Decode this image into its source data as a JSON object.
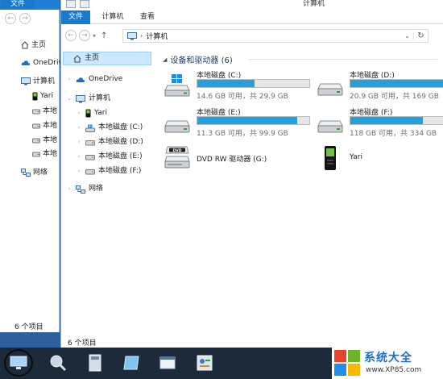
{
  "bg_window": {
    "file_tab": "文件",
    "nav": [
      {
        "label": "主页",
        "icon": "home-icon"
      },
      {
        "label": "OneDrive",
        "icon": "cloud-icon"
      },
      {
        "label": "计算机",
        "icon": "computer-icon"
      },
      {
        "label": "Yari",
        "icon": "phone-icon"
      },
      {
        "label": "本地",
        "icon": "drive-icon"
      },
      {
        "label": "本地",
        "icon": "drive-icon"
      },
      {
        "label": "本地",
        "icon": "drive-icon"
      },
      {
        "label": "本地",
        "icon": "drive-icon"
      },
      {
        "label": "网络",
        "icon": "network-icon"
      }
    ],
    "status": "6 个项目"
  },
  "window": {
    "title": "计算机",
    "tabs": [
      "文件",
      "计算机",
      "查看"
    ],
    "address": "计算机",
    "nav": [
      {
        "label": "主页",
        "icon": "home-icon"
      },
      {
        "label": "OneDrive",
        "icon": "cloud-icon"
      },
      {
        "label": "计算机",
        "icon": "computer-icon"
      },
      {
        "label": "Yari",
        "icon": "phone-icon"
      },
      {
        "label": "本地磁盘 (C:)",
        "icon": "windows-drive-icon"
      },
      {
        "label": "本地磁盘 (D:)",
        "icon": "drive-icon"
      },
      {
        "label": "本地磁盘 (E:)",
        "icon": "drive-icon"
      },
      {
        "label": "本地磁盘 (F:)",
        "icon": "drive-icon"
      },
      {
        "label": "网络",
        "icon": "network-icon"
      }
    ],
    "group_header": "设备和驱动器 (6)",
    "drives": [
      {
        "name": "本地磁盘 (C:)",
        "capacity": "14.6 GB 可用，共 29.9 GB",
        "used_fraction": 0.51,
        "icon": "windows-drive-icon"
      },
      {
        "name": "本地磁盘 (D:)",
        "capacity": "20.9 GB 可用，共 169 GB",
        "used_fraction": 0.88,
        "icon": "drive-icon"
      },
      {
        "name": "本地磁盘 (E:)",
        "capacity": "11.3 GB 可用，共 99.9 GB",
        "used_fraction": 0.89,
        "icon": "drive-icon"
      },
      {
        "name": "本地磁盘 (F:)",
        "capacity": "118 GB 可用，共 334 GB",
        "used_fraction": 0.65,
        "icon": "drive-icon"
      }
    ],
    "devices": [
      {
        "name": "DVD RW 驱动器 (G:)",
        "icon": "dvd-drive-icon"
      },
      {
        "name": "Yari",
        "icon": "phone-icon"
      }
    ],
    "status": "6 个项目"
  },
  "taskbar": {
    "logo_text": "系统大全",
    "logo_url": "www.XP85.com"
  }
}
